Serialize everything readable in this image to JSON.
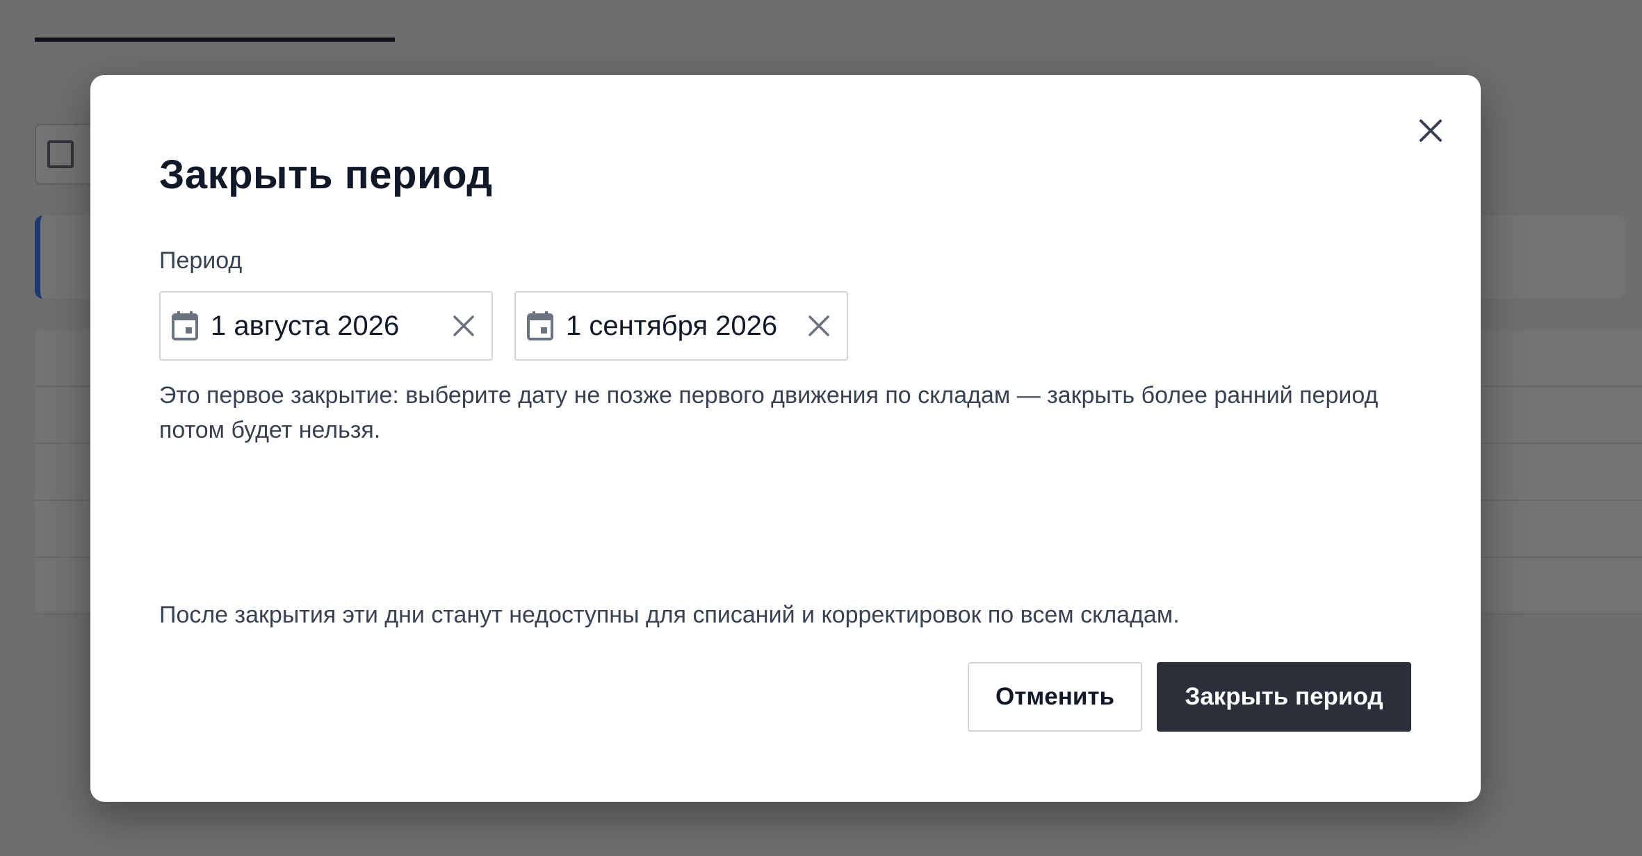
{
  "modal": {
    "title": "Закрыть период",
    "period_label": "Период",
    "date_from": "1 августа 2026",
    "date_to": "1 сентября 2026",
    "hint": "Это первое закрытие: выберите дату не позже первого движения по складам — закрыть более ранний период потом будет нельзя.",
    "footer_note": "После закрытия эти дни станут недоступны для списаний и корректировок по всем складам.",
    "cancel_label": "Отменить",
    "confirm_label": "Закрыть период"
  },
  "colors": {
    "confirm_button": "#2b2f3a",
    "overlay": "rgba(0,0,0,0.55)",
    "active_accent": "#3b82f6"
  },
  "icons": {
    "close": "close-icon",
    "calendar": "calendar-icon",
    "clear": "clear-icon"
  }
}
